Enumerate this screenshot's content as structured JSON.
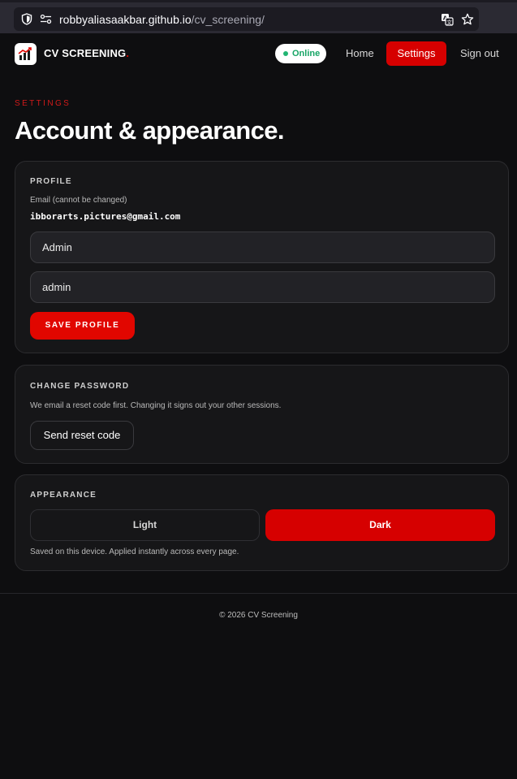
{
  "browser": {
    "url_host": "robbyaliasaakbar.github.io",
    "url_path": "/cv_screening/",
    "icons": [
      "shield-icon",
      "permissions-icon",
      "translate-icon",
      "bookmark-star-icon"
    ]
  },
  "nav": {
    "brand": "CV SCREENING",
    "brand_suffix": ".",
    "status": "Online",
    "home": "Home",
    "settings": "Settings",
    "signout": "Sign out",
    "logo_icon": "bar-chart-trending-icon"
  },
  "page": {
    "eyebrow": "SETTINGS",
    "title": "Account & appearance."
  },
  "profile": {
    "heading": "PROFILE",
    "email_label": "Email (cannot be changed)",
    "email": "ibborarts.pictures@gmail.com",
    "name_value": "Admin",
    "username_value": "admin",
    "save_label": "SAVE PROFILE"
  },
  "password": {
    "heading": "CHANGE PASSWORD",
    "description": "We email a reset code first. Changing it signs out your other sessions.",
    "button": "Send reset code"
  },
  "appearance": {
    "heading": "APPEARANCE",
    "option_light": "Light",
    "option_dark": "Dark",
    "selected": "Dark",
    "note": "Saved on this device. Applied instantly across every page."
  },
  "footer": {
    "text": "© 2026 CV Screening"
  },
  "colors": {
    "accent": "#e10600",
    "background": "#0e0e10",
    "card": "#161618",
    "online": "#22b573"
  }
}
